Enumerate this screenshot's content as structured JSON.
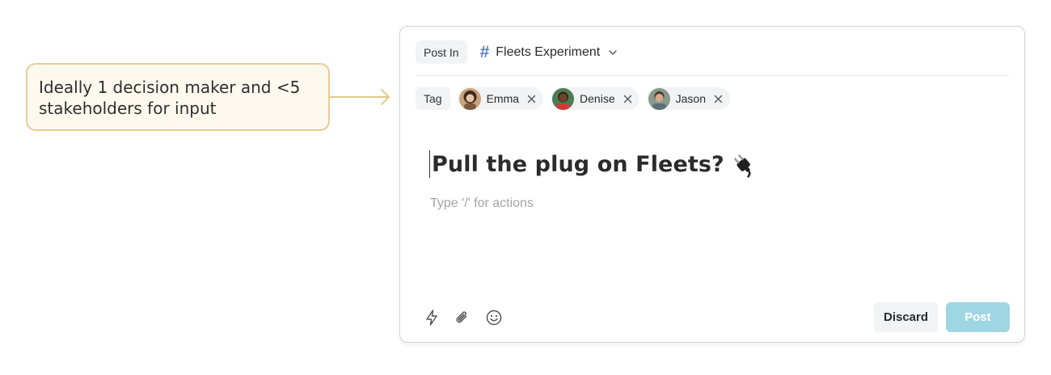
{
  "callout": {
    "text": "Ideally 1 decision maker and <5 stakeholders for input",
    "border_color": "#e7cd94",
    "bg_color": "#fef9ef"
  },
  "composer": {
    "post_in_label": "Post In",
    "channel": {
      "icon": "hash-icon",
      "name": "Fleets Experiment"
    },
    "tag_label": "Tag",
    "tags": [
      {
        "name": "Emma"
      },
      {
        "name": "Denise"
      },
      {
        "name": "Jason"
      }
    ],
    "title": "Pull the plug on Fleets?",
    "title_icon": "electric-plug-icon",
    "body_placeholder": "Type '/' for actions",
    "toolbar_icons": [
      "lightning-icon",
      "paperclip-icon",
      "smiley-icon"
    ],
    "discard_label": "Discard",
    "post_label": "Post",
    "post_color": "#9fd6e3"
  }
}
